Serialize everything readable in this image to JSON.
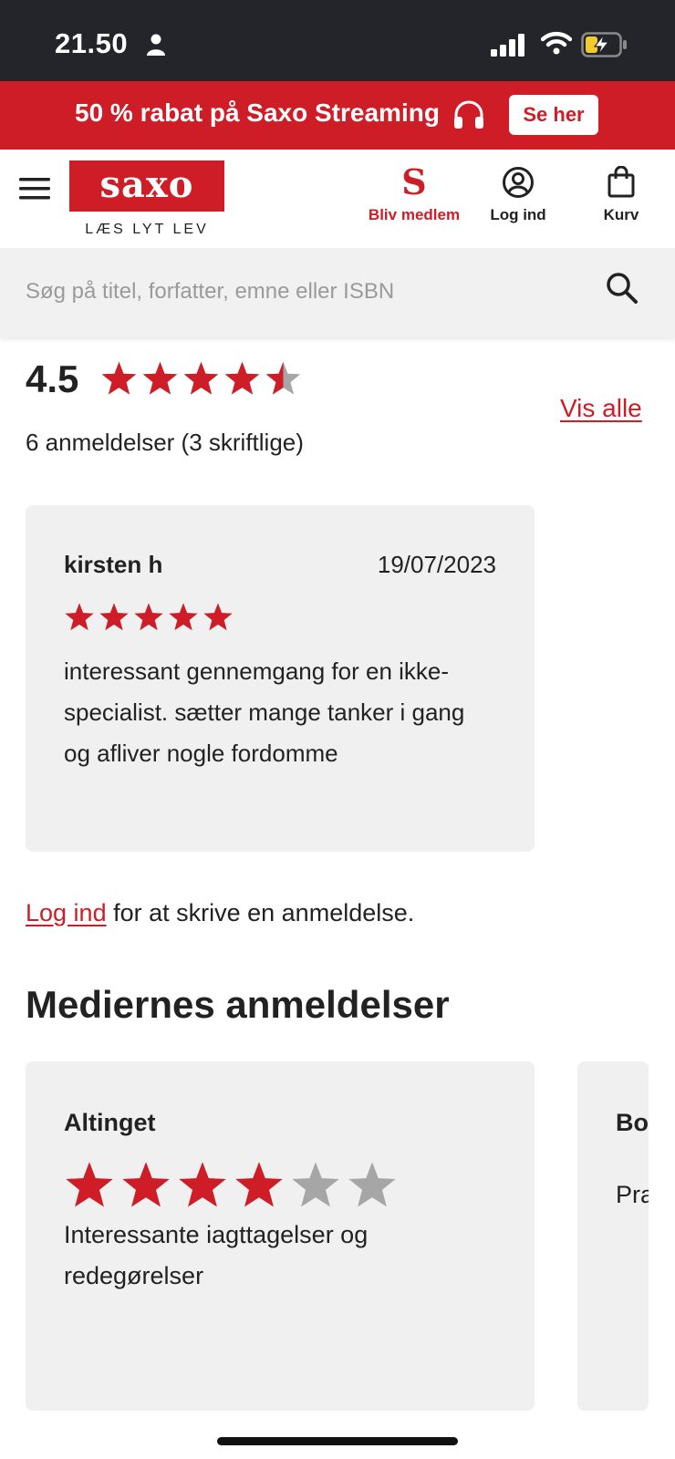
{
  "status_bar": {
    "time": "21.50"
  },
  "promo": {
    "text": "50 % rabat på Saxo Streaming",
    "button": "Se her"
  },
  "header": {
    "logo": "saxo",
    "tagline": "LÆS LYT LEV",
    "member_mark": "S",
    "member_label": "Bliv medlem",
    "login_label": "Log ind",
    "cart_label": "Kurv"
  },
  "search": {
    "placeholder": "Søg på titel, forfatter, emne eller ISBN",
    "value": ""
  },
  "rating": {
    "value": "4.5",
    "stars": 4.5,
    "see_all": "Vis alle",
    "count_text": "6 anmeldelser (3 skriftlige)"
  },
  "review": {
    "author": "kirsten h",
    "date": "19/07/2023",
    "stars": 5,
    "text": "interessant gennemgang for en ikke-specialist. sætter mange tanker i gang og afliver nogle fordomme"
  },
  "login_prompt": {
    "link": "Log ind",
    "rest": " for at skrive en anmeldelse."
  },
  "media": {
    "heading": "Mediernes anmeldelser",
    "cards": [
      {
        "source": "Altinget",
        "stars": 4,
        "max_stars": 6,
        "text": "Interessante iagttagelser og redegørelser"
      },
      {
        "source": "Bo",
        "text": "Pra som"
      }
    ]
  },
  "colors": {
    "brand_red": "#cf1d27",
    "star_red": "#cf1d27",
    "star_grey": "#a6a6a6",
    "card_bg": "#f0f0f0"
  }
}
